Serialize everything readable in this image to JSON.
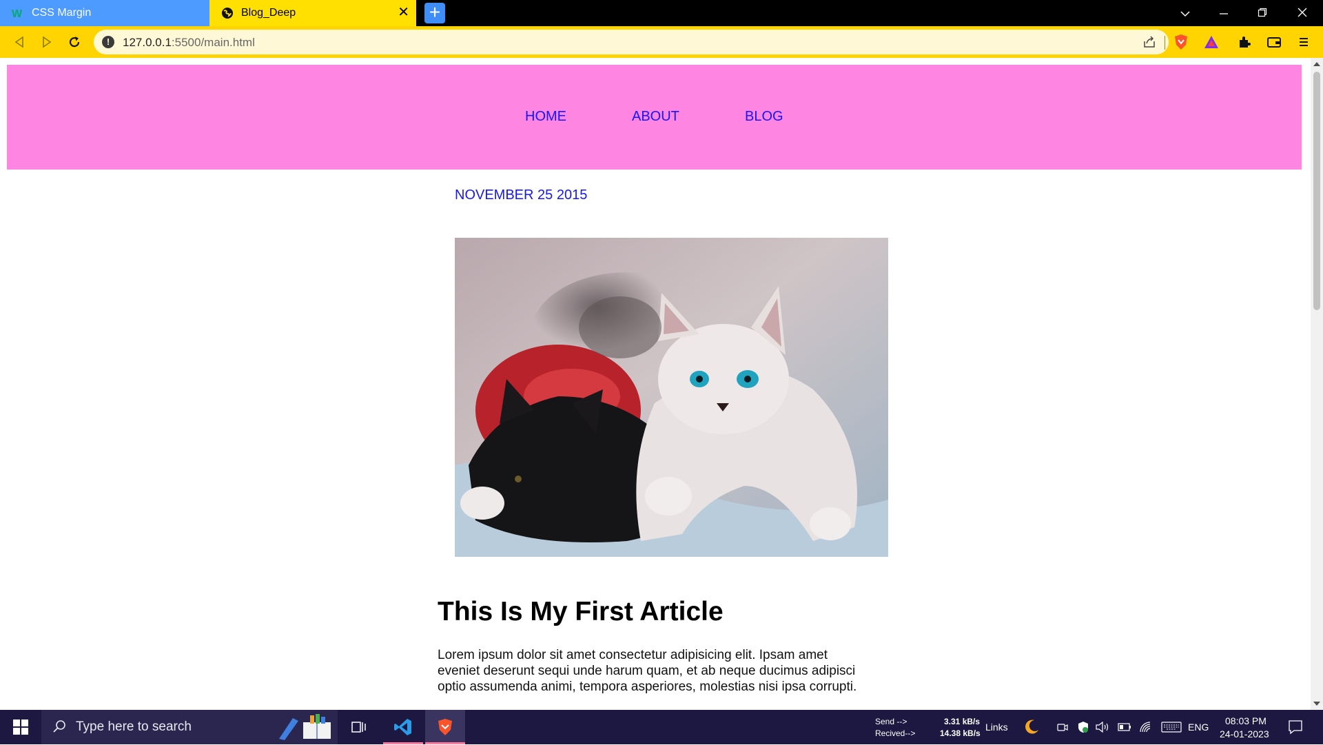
{
  "browser": {
    "tabs": [
      {
        "title": "CSS Margin",
        "favicon": "w3schools-icon",
        "active": false
      },
      {
        "title": "Blog_Deep",
        "favicon": "globe-icon",
        "active": true
      }
    ],
    "new_tab_label": "+",
    "close_label": "✕",
    "address": {
      "host": "127.0.0.1",
      "path": ":5500/main.html"
    },
    "accent": "#ffd400",
    "tab_inactive_color": "#4d9bff"
  },
  "page": {
    "nav": [
      "HOME",
      "ABOUT",
      "BLOG"
    ],
    "header_color": "#ff85e2",
    "link_color": "#1515ff",
    "date": "NOVEMBER 25 2015",
    "image_alt": "kittens-photo",
    "title": "This Is My First Article",
    "body": "Lorem ipsum dolor sit amet consectetur adipisicing elit. Ipsam amet eveniet deserunt sequi unde harum quam, et ab neque ducimus adipisci optio assumenda animi, tempora asperiores, molestias nisi ipsa corrupti."
  },
  "taskbar": {
    "search_placeholder": "Type here to search",
    "net_send_label": "Send -->",
    "net_recv_label": "Recived-->",
    "net_send_speed": "3.31 kB/s",
    "net_recv_speed": "14.38 kB/s",
    "links_label": "Links",
    "language": "ENG",
    "time": "08:03 PM",
    "date": "24-01-2023"
  }
}
